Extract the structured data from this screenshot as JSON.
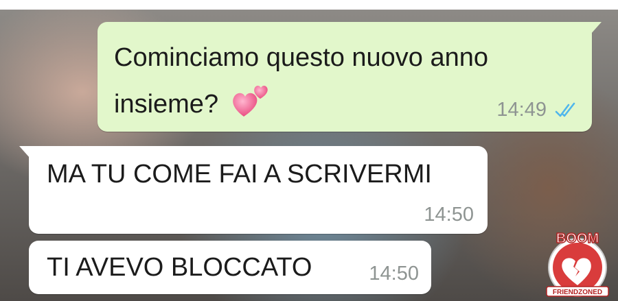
{
  "messages": [
    {
      "direction": "outgoing",
      "text": "Cominciamo questo nuovo anno insieme?",
      "emoji": "two-hearts",
      "time": "14:49",
      "status": "read",
      "status_color": "#4fb6ec"
    },
    {
      "direction": "incoming",
      "text": "MA TU COME FAI A SCRIVERMI",
      "time": "14:50"
    },
    {
      "direction": "incoming",
      "text": "TI AVEVO BLOCCATO",
      "time": "14:50"
    }
  ],
  "watermark": {
    "top_text": "BOOM",
    "bottom_text": "FRIENDZONED",
    "icon": "broken-heart-icon"
  },
  "colors": {
    "outgoing_bubble": "#e2f7cb",
    "incoming_bubble": "#ffffff",
    "timestamp": "#8e9492",
    "heart_pink": "#f05a8a"
  }
}
